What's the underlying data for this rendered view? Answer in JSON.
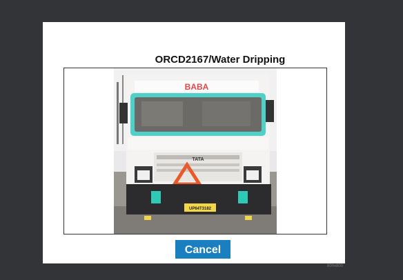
{
  "dialog": {
    "title": "ORCD2167/Water Dripping",
    "cancel_label": "Cancel",
    "footnote": "800x800",
    "photo": {
      "destination_text": "BABA",
      "grille_brand": "TATA",
      "plate_text": "UP64T3182"
    }
  },
  "colors": {
    "background": "#333438",
    "dialog_bg": "#ffffff",
    "button_bg": "#1a7fc0",
    "truck_accent": "#4fd0c8"
  }
}
